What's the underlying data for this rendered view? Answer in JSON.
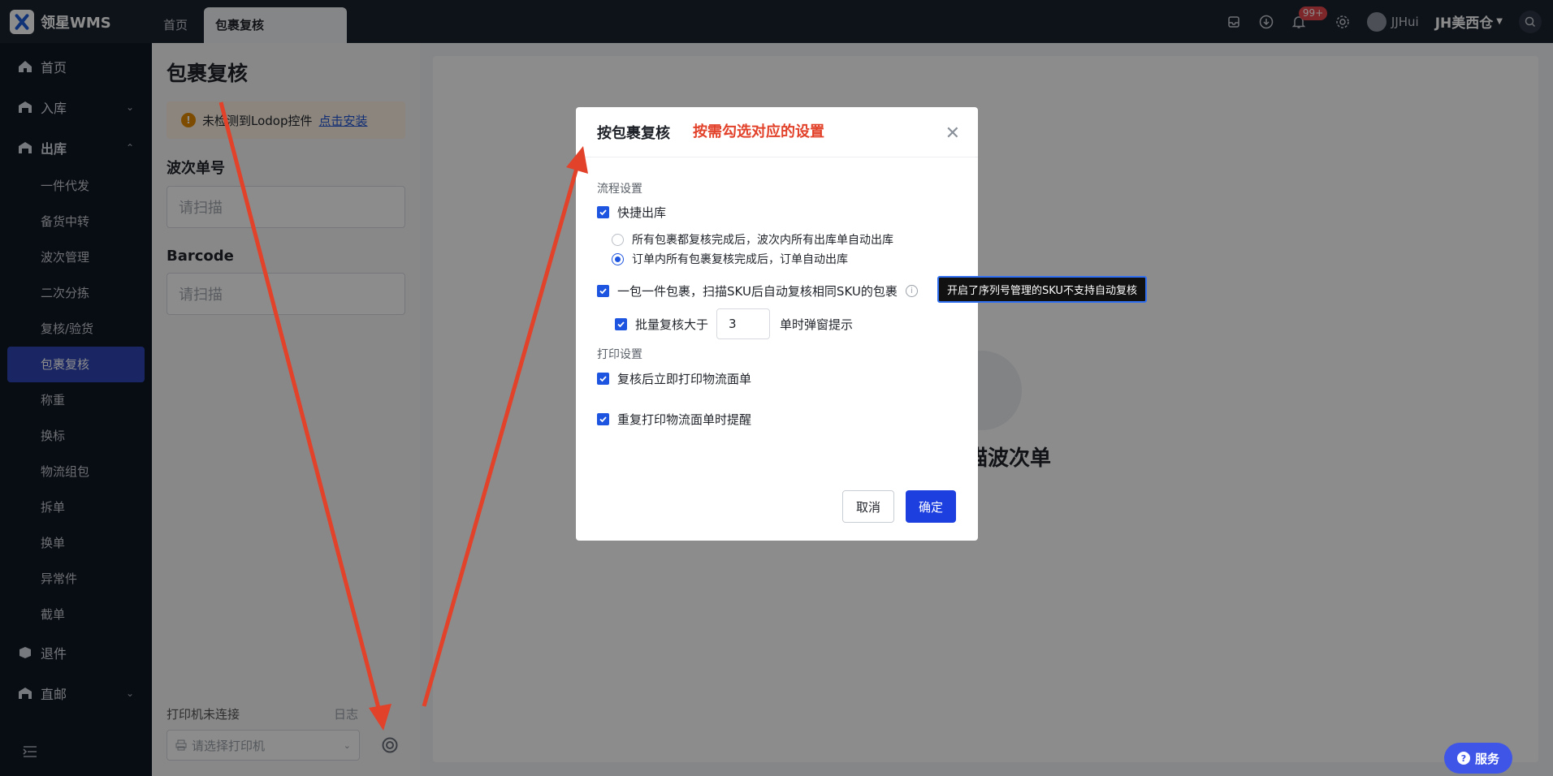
{
  "app": {
    "name": "领星WMS"
  },
  "tabs": [
    {
      "label": "首页"
    },
    {
      "label": "包裹复核"
    }
  ],
  "header": {
    "badge": "99+",
    "user": "JJHui",
    "warehouse": "JH美西仓"
  },
  "sidebar": {
    "items": [
      {
        "label": "首页"
      },
      {
        "label": "入库"
      },
      {
        "label": "出库"
      },
      {
        "label": "退件"
      },
      {
        "label": "直邮"
      }
    ],
    "sub_items": [
      "一件代发",
      "备货中转",
      "波次管理",
      "二次分拣",
      "复核/验货",
      "包裹复核",
      "称重",
      "换标",
      "物流组包",
      "拆单",
      "换单",
      "异常件",
      "截单"
    ]
  },
  "left_panel": {
    "title": "包裹复核",
    "warning": "未检测到Lodop控件",
    "install_link": "点击安装",
    "wave_label": "波次单号",
    "wave_placeholder": "请扫描",
    "barcode_label": "Barcode",
    "barcode_placeholder": "请扫描",
    "printer_status": "打印机未连接",
    "log_label": "日志",
    "printer_placeholder": "请选择打印机"
  },
  "main": {
    "scan_prompt": "描波次单"
  },
  "modal": {
    "title": "按包裹复核",
    "note": "按需勾选对应的设置",
    "section_flow": "流程设置",
    "quick_outbound": "快捷出库",
    "radio_all_wave": "所有包裹都复核完成后，波次内所有出库单自动出库",
    "radio_order": "订单内所有包裹复核完成后，订单自动出库",
    "one_piece": "一包一件包裹，扫描SKU后自动复核相同SKU的包裹",
    "batch_prefix": "批量复核大于",
    "batch_value": "3",
    "batch_suffix": "单时弹窗提示",
    "section_print": "打印设置",
    "print_after": "复核后立即打印物流面单",
    "reprint_remind": "重复打印物流面单时提醒",
    "cancel": "取消",
    "confirm": "确定"
  },
  "tooltip": "开启了序列号管理的SKU不支持自动复核",
  "service": "服务",
  "colors": {
    "accent": "#1d54e0",
    "annotation": "#e2412a",
    "topbar": "#1b2331",
    "sidebar": "#0f1623"
  }
}
